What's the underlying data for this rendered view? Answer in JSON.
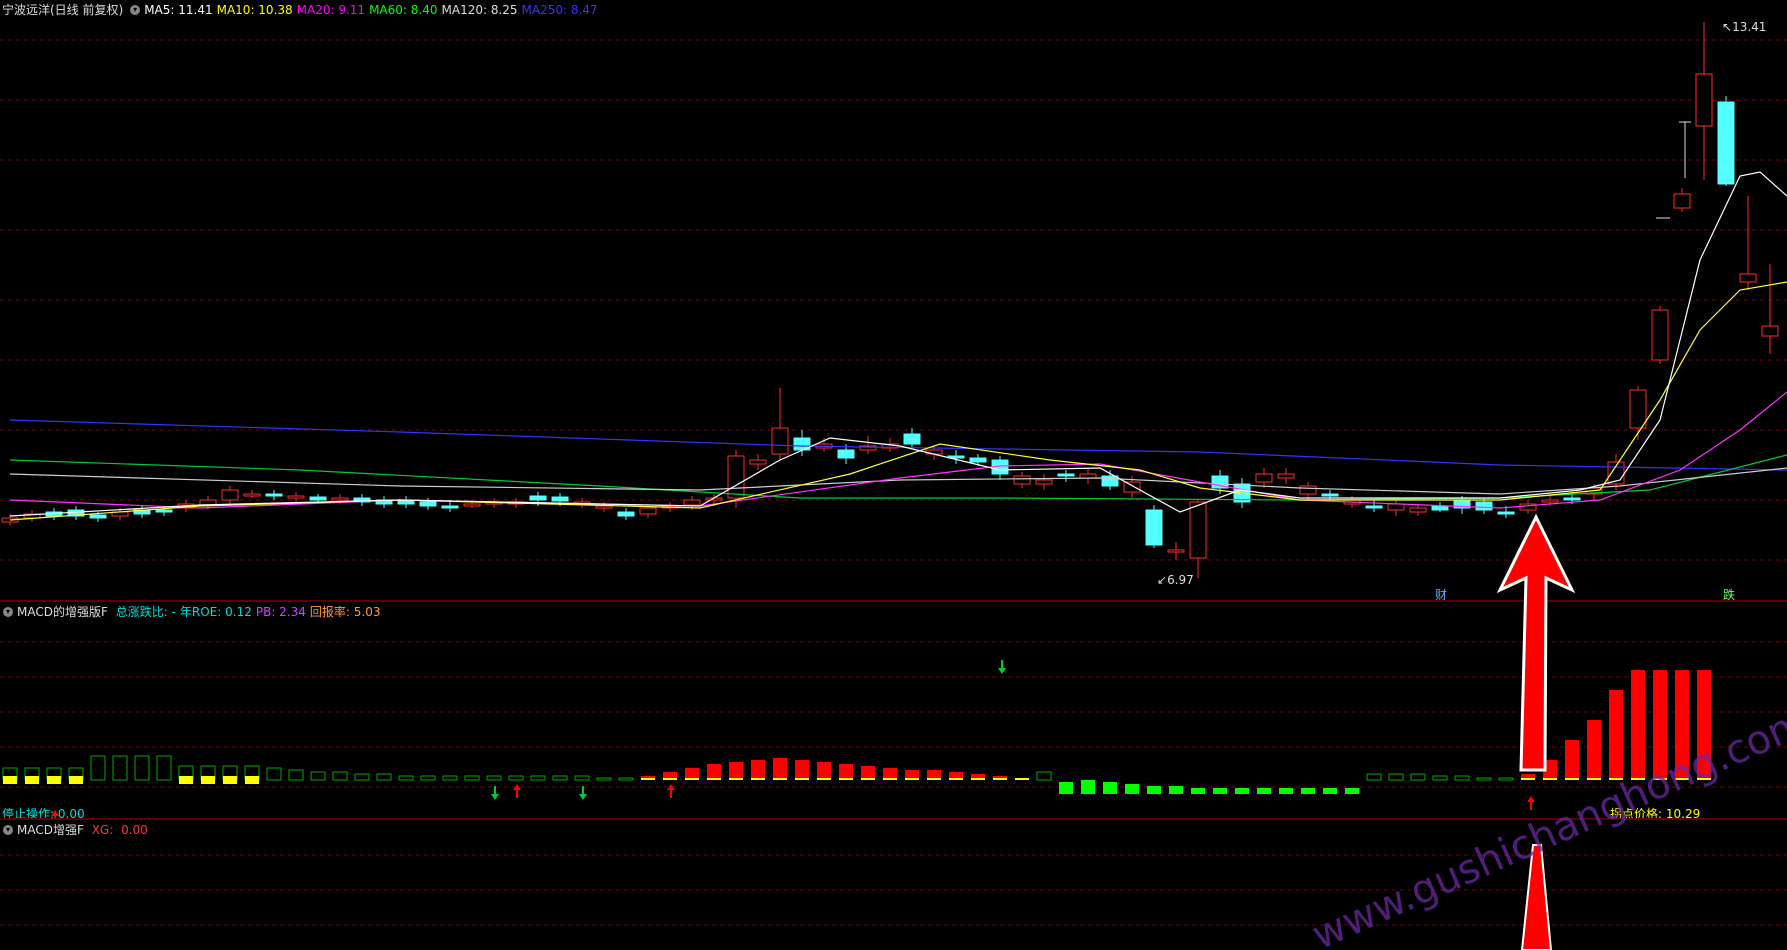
{
  "main_panel": {
    "stock_title": "宁波远洋(日线 前复权)",
    "ma_indicators": [
      {
        "label": "MA5:",
        "value": "11.41",
        "color": "#ffffff"
      },
      {
        "label": "MA10:",
        "value": "10.38",
        "color": "#ffff00"
      },
      {
        "label": "MA20:",
        "value": "9.11",
        "color": "#ff00ff"
      },
      {
        "label": "MA60:",
        "value": "8.40",
        "color": "#00ff00"
      },
      {
        "label": "MA120:",
        "value": "8.25",
        "color": "#dddddd"
      },
      {
        "label": "MA250:",
        "value": "8.47",
        "color": "#3333ff"
      }
    ],
    "high_label": "13.41",
    "low_label": "6.97",
    "event_marks": [
      "财",
      "跌"
    ]
  },
  "macd_panel": {
    "indicator_name": "MACD的增强版F",
    "stats": [
      {
        "label": "总涨跌比:",
        "value": "-",
        "color": "#00dddd"
      },
      {
        "label": "年ROE:",
        "value": "0.12",
        "color": "#00dddd"
      },
      {
        "label": "PB:",
        "value": "2.34",
        "color": "#cc44ff"
      },
      {
        "label": "回报率:",
        "value": "5.03",
        "color": "#ff9933"
      }
    ],
    "stop_label": "停止操作:",
    "stop_value": "0.00",
    "price_label": "拐点价格:",
    "price_value": "10.29"
  },
  "bottom_panel": {
    "indicator_name": "MACD增强F",
    "xg_label": "XG:",
    "xg_value": "0.00"
  },
  "watermark": "www.gushichanghong.com",
  "colors": {
    "up": "#ff2a2a",
    "down": "#54ffff",
    "grid": "#7a0000",
    "buy_arrow": "#ff0000",
    "sell_arrow": "#00cc33",
    "bar_yellow": "#ffff00",
    "bar_red": "#ff0000",
    "bar_green": "#00ff00"
  }
}
